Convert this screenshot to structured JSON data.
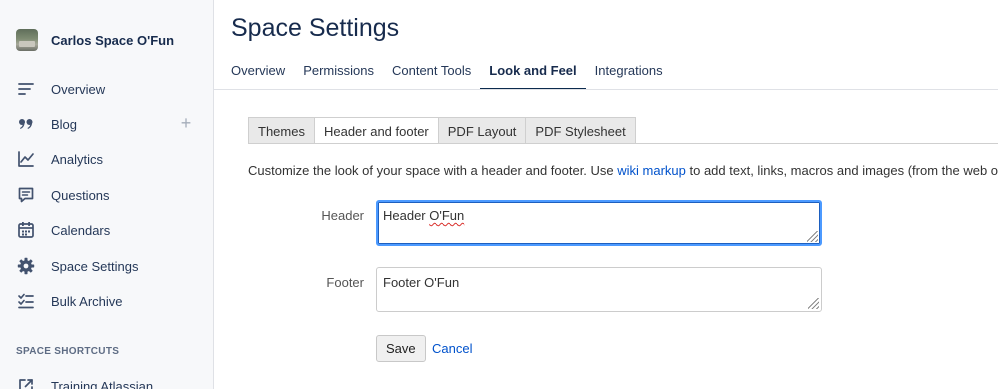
{
  "sidebar": {
    "space_name": "Carlos Space O'Fun",
    "items": [
      {
        "label": "Overview",
        "icon": "overview-icon"
      },
      {
        "label": "Blog",
        "icon": "quote-icon"
      },
      {
        "label": "Analytics",
        "icon": "chart-icon"
      },
      {
        "label": "Questions",
        "icon": "question-icon"
      },
      {
        "label": "Calendars",
        "icon": "calendar-icon"
      },
      {
        "label": "Space Settings",
        "icon": "gear-icon"
      },
      {
        "label": "Bulk Archive",
        "icon": "archive-icon"
      }
    ],
    "add_icon": "plus-icon",
    "shortcuts_title": "SPACE SHORTCUTS",
    "shortcuts": [
      {
        "label": "Training Atlassian",
        "icon": "external-link-icon"
      }
    ]
  },
  "main": {
    "title": "Space Settings",
    "tabs": [
      {
        "label": "Overview"
      },
      {
        "label": "Permissions"
      },
      {
        "label": "Content Tools"
      },
      {
        "label": "Look and Feel",
        "active": true
      },
      {
        "label": "Integrations"
      }
    ],
    "sub_tabs": [
      {
        "label": "Themes"
      },
      {
        "label": "Header and footer",
        "active": true
      },
      {
        "label": "PDF Layout"
      },
      {
        "label": "PDF Stylesheet"
      }
    ],
    "description": {
      "before": "Customize the look of your space with a header and footer. Use ",
      "link": "wiki markup",
      "after": " to add text, links, macros and images (from the web or attachments)."
    },
    "form": {
      "header_label": "Header",
      "header_value_prefix": "Header ",
      "header_value_misspelled": "O'Fun",
      "footer_label": "Footer",
      "footer_value": "Footer O'Fun",
      "save_label": "Save",
      "cancel_label": "Cancel"
    }
  },
  "colors": {
    "accent": "#0052cc",
    "focus": "#4c9aff",
    "active_tab_underline": "#0c2b4e"
  }
}
